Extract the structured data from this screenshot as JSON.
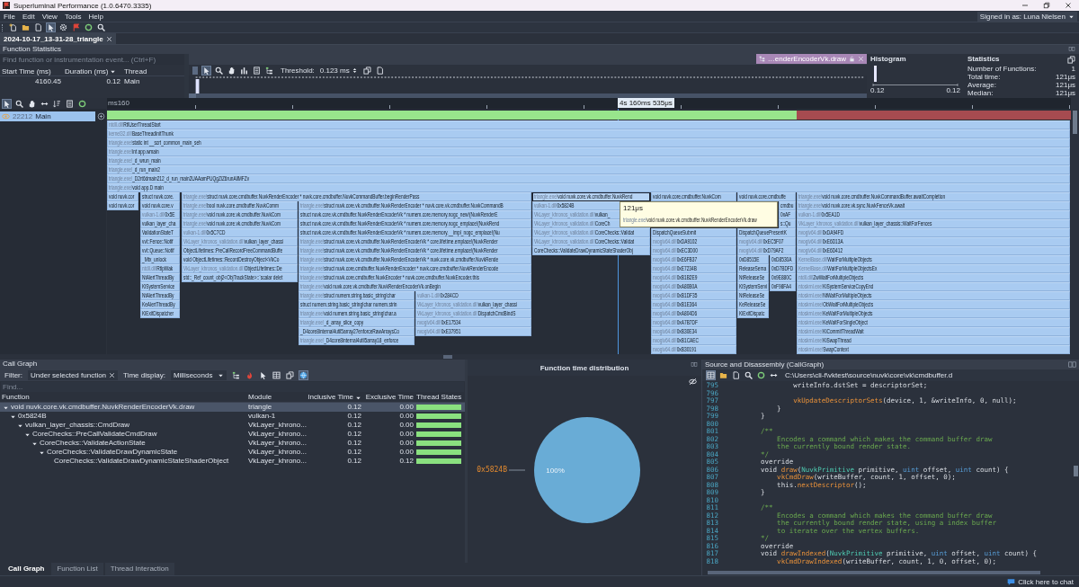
{
  "window": {
    "title": "Superluminal Performance (1.0.6470.3335)"
  },
  "menu": [
    "File",
    "Edit",
    "View",
    "Tools",
    "Help"
  ],
  "account": {
    "label": "Signed in as: Luna Nielsen"
  },
  "document_tabs": [
    {
      "label": "2024-10-17_13-31-28_triangle",
      "selected": true
    }
  ],
  "function_statistics": {
    "title": "Function Statistics",
    "search": {
      "placeholder": "Find function or instrumentation event... (Ctrl+F)"
    },
    "columns": [
      {
        "label": "Start Time (ms)",
        "sorted": false
      },
      {
        "label": "Duration (ms)",
        "sorted": true
      },
      {
        "label": "Thread",
        "sorted": false
      }
    ],
    "rows": [
      [
        "4160.45",
        "0.12",
        "Main"
      ]
    ],
    "threshold_label": "Threshold:",
    "threshold_value": "0.123 ms",
    "selection_tab": "…enderEncoderVk.draw"
  },
  "histogram": {
    "title": "Histogram",
    "min_label": "0.12",
    "max_label": "0.12"
  },
  "statistics": {
    "title": "Statistics",
    "rows": [
      {
        "label": "Number of Functions:",
        "value": "1"
      },
      {
        "label": "Total time:",
        "value": "121μs"
      },
      {
        "label": "Average:",
        "value": "121μs"
      },
      {
        "label": "Median:",
        "value": "121μs"
      }
    ]
  },
  "timeline": {
    "start_label": "ms160",
    "cursor_label": "4s 160ms 535μs"
  },
  "threads": [
    {
      "id": "22212",
      "name": "Main",
      "selected": true
    }
  ],
  "thread_state_segments": [
    {
      "color": "#98e58c"
    },
    {
      "color": "#a64b50"
    }
  ],
  "flame_rows": [
    {
      "blocks": [
        {
          "module": "ntdll.dll!",
          "name": "RtlUserThreadStart",
          "selected": false
        }
      ]
    },
    {
      "blocks": [
        {
          "module": "kernel32.dll!",
          "name": "BaseThreadInitThunk",
          "selected": false
        }
      ]
    },
    {
      "blocks": [
        {
          "module": "triangle.exe!",
          "name": "static int __scrt_common_main_seh",
          "selected": false
        }
      ]
    },
    {
      "blocks": [
        {
          "module": "triangle.exe!",
          "name": "int app.wmain",
          "selected": false
        }
      ]
    },
    {
      "blocks": [
        {
          "module": "triangle.exe!",
          "name": "_d_wrun_main",
          "selected": false
        }
      ]
    },
    {
      "blocks": [
        {
          "module": "triangle.exe!",
          "name": "_d_run_main2",
          "selected": false
        }
      ]
    },
    {
      "blocks": [
        {
          "module": "triangle.exe!",
          "name": "_D2rt6dmain212_d_run_main2UAAamPUQgZiZ6runAllMFZv",
          "selected": false
        }
      ]
    },
    {
      "blocks": [
        {
          "module": "triangle.exe!",
          "name": "void app.D main",
          "selected": false
        }
      ]
    },
    {
      "blocks": [
        {
          "name": "void nuvk.cor",
          "selected": false
        },
        {
          "name": "struct nuvk.core.",
          "selected": false
        },
        {
          "module": "triangle.exe!",
          "name": "struct nuvk.core.cmdbuffer.NuvkRenderEncoder * nuvk.core.cmdbuffer.NuvkCommandBuffer.beginRenderPass",
          "selected": false
        },
        {
          "module": "triangle.exe!",
          "name": "void nuvk.core.vk.cmdbuffer.NuvkRend",
          "selected": true
        },
        {
          "name": "void nuvk.core.cmdbuffer.NuvkCom",
          "selected": false
        },
        {
          "name": "void nuvk.core.cmdbuffe",
          "selected": false
        },
        {
          "module": "triangle.exe!",
          "name": "void nuvk.core.cmdbuffer.NuvkCommandBuffer.awaitCompletion",
          "selected": false
        }
      ]
    },
    {
      "blocks": [
        {
          "name": "void nuvk.cor",
          "selected": false
        },
        {
          "name": "void nuvk.core.v",
          "selected": false
        },
        {
          "module": "triangle.exe!",
          "name": "bool nuvk.core.cmdbuffer.NuvkComm",
          "selected": false
        },
        {
          "module": "triangle.exe!",
          "name": "struct nuvk.core.vk.cmdbuffer.NuvkRenderEncoder * nuvk.core.vk.cmdbuffer.NuvkCommandB",
          "selected": false
        },
        {
          "module": "vulkan-1.dll!",
          "name": "0x5824B",
          "selected": false
        },
        {
          "name": "cmdbu",
          "selected": false
        },
        {
          "module": "triangle.exe!",
          "name": "void nuvk.core.vk.sync.NuvkFenceVk.await",
          "selected": false
        }
      ]
    },
    {
      "blocks": [
        {
          "module": "vulkan-1.dll!",
          "name": "0x5E",
          "selected": false
        },
        {
          "module": "triangle.exe!",
          "name": "void nuvk.core.vk.cmdbuffer.NuvkCom",
          "selected": false
        },
        {
          "name": "struct nuvk.core.vk.cmdbuffer.NuvkRenderEncoderVk * numem.core.memory.nogc_new!(NuvkRenderE",
          "selected": false
        },
        {
          "module": "VkLayer_khronos_validation.dll!",
          "name": "vulkan_",
          "selected": false
        },
        {
          "name": "0xAF",
          "selected": false
        },
        {
          "module": "vulkan-1.dll!",
          "name": "0x5EA1D",
          "selected": false
        }
      ]
    },
    {
      "blocks": [
        {
          "name": "vulkan_layer_cha",
          "selected": false
        },
        {
          "module": "triangle.exe!",
          "name": "void nuvk.core.vk.cmdbuffer.NuvkCom",
          "selected": false
        },
        {
          "name": "struct nuvk.core.vk.cmdbuffer.NuvkRenderEncoderVk * numem.core.memory.nogc_emplace!(NuvkRend",
          "selected": false
        },
        {
          "module": "VkLayer_khronos_validation.dll!",
          "name": "CoreCh",
          "selected": false
        },
        {
          "name": "s::Qu",
          "selected": false
        },
        {
          "module": "VkLayer_khronos_validation.dll!",
          "name": "vulkan_layer_chassis::WaitForFences",
          "selected": false
        }
      ]
    },
    {
      "blocks": [
        {
          "name": "ValidationStateT",
          "selected": false
        },
        {
          "module": "vulkan-1.dll!",
          "name": "0x5C7CD",
          "selected": false
        },
        {
          "name": "struct nuvk.core.vk.cmdbuffer.NuvkRenderEncoderVk * numem.core.memory.__impl_nogc_emplace!(Nu",
          "selected": false
        },
        {
          "module": "VkLayer_khronos_validation.dll!",
          "name": "CoreChecks::Validat",
          "selected": false
        },
        {
          "name": "DispatchQueueSubmit",
          "selected": false
        },
        {
          "name": "DispatchQueuePresentK",
          "selected": false
        },
        {
          "module": "nvoglv64.dll!",
          "name": "0xDA94FD",
          "selected": false
        }
      ]
    },
    {
      "blocks": [
        {
          "name": "vvl::Fence::Notif",
          "selected": false
        },
        {
          "module": "VkLayer_khronos_validation.dll!",
          "name": "vulkan_layer_chassi",
          "selected": false
        },
        {
          "module": "triangle.exe!",
          "name": "struct nuvk.core.vk.cmdbuffer.NuvkRenderEncoderVk * core.lifetime.emplace!(NuvkRender",
          "selected": false
        },
        {
          "module": "VkLayer_khronos_validation.dll!",
          "name": "CoreChecks::Validat",
          "selected": false
        },
        {
          "module": "nvoglv64.dll!",
          "name": "0xDA9102",
          "selected": false
        },
        {
          "module": "nvoglv64.dll!",
          "name": "0xEC5F07",
          "selected": false
        },
        {
          "module": "nvoglv64.dll!",
          "name": "0xE6D13A",
          "selected": false
        }
      ]
    },
    {
      "blocks": [
        {
          "name": "vvl::Queue::Notif",
          "selected": false
        },
        {
          "name": "ObjectLifetimes::PreCallRecordFreeCommandBuffe",
          "selected": false
        },
        {
          "module": "triangle.exe!",
          "name": "struct nuvk.core.vk.cmdbuffer.NuvkRenderEncoderVk * core.lifetime.emplace!(NuvkRender",
          "selected": false
        },
        {
          "name": "CoreChecks::ValidateDrawDynamicStateShaderObj",
          "selected": false
        },
        {
          "module": "nvoglv64.dll!",
          "name": "0xEC3D00",
          "selected": false
        },
        {
          "module": "nvoglv64.dll!",
          "name": "0xD79AF2",
          "selected": false
        },
        {
          "module": "nvoglv64.dll!",
          "name": "0xE6D412",
          "selected": false
        }
      ]
    },
    {
      "blocks": [
        {
          "name": "_Mtx_unlock",
          "selected": false
        },
        {
          "name": "void ObjectLifetimes::RecordDestroyObject<VkCo",
          "selected": false
        },
        {
          "module": "triangle.exe!",
          "name": "struct nuvk.core.vk.cmdbuffer.NuvkRenderEncoderVk * nuvk.core.vk.cmdbuffer.NuvkRende",
          "selected": false
        },
        {
          "module": "nvoglv64.dll!",
          "name": "0xE6FB37",
          "selected": false
        },
        {
          "name": "0xD8515E",
          "selected": false
        },
        {
          "name": "0xD8530A",
          "selected": false
        },
        {
          "module": "KernelBase.dll!",
          "name": "WaitForMultipleObjects",
          "selected": false
        }
      ]
    },
    {
      "blocks": [
        {
          "module": "ntdll.dll!",
          "name": "RtlpWak",
          "selected": false
        },
        {
          "module": "VkLayer_khronos_validation.dll!",
          "name": "ObjectLifetimes::De",
          "selected": false
        },
        {
          "module": "triangle.exe!",
          "name": "struct nuvk.core.cmdbuffer.NuvkRenderEncoder * nuvk.core.cmdbuffer.NuvkRenderEncode",
          "selected": false
        },
        {
          "module": "nvoglv64.dll!",
          "name": "0xE7234B",
          "selected": false
        },
        {
          "name": "ReleaseSema",
          "selected": false
        },
        {
          "name": "0xD7BDFD",
          "selected": false
        },
        {
          "module": "KernelBase.dll!",
          "name": "WaitForMultipleObjectsEx",
          "selected": false
        }
      ]
    },
    {
      "blocks": [
        {
          "name": "NtAlertThreadBy",
          "selected": false
        },
        {
          "name": "std::_Ref_count_obj2<ObjTrackState>::`scalar delet",
          "selected": false
        },
        {
          "module": "triangle.exe!",
          "name": "struct nuvk.core.cmdbuffer.NuvkEncoder * nuvk.core.cmdbuffer.NuvkEncoder.this",
          "selected": false
        },
        {
          "module": "nvoglv64.dll!",
          "name": "0xB1B2E9",
          "selected": false
        },
        {
          "name": "NtReleaseSe",
          "selected": false
        },
        {
          "name": "0x9E880C",
          "selected": false
        },
        {
          "module": "ntdll.dll!",
          "name": "ZwWaitForMultipleObjects",
          "selected": false
        }
      ]
    },
    {
      "blocks": [
        {
          "name": "KiSystemService",
          "selected": false
        },
        {
          "module": "triangle.exe!",
          "name": "void nuvk.core.vk.cmdbuffer.NuvkRenderEncoderVk.onBegin",
          "selected": false
        },
        {
          "module": "nvoglv64.dll!",
          "name": "0xA80B0A",
          "selected": false
        },
        {
          "name": "KiSystemServi",
          "selected": false
        },
        {
          "name": "0xF98FA4",
          "selected": false
        },
        {
          "module": "ntoskrnl.exe!",
          "name": "KiSystemServiceCopyEnd",
          "selected": false
        }
      ]
    },
    {
      "blocks": [
        {
          "name": "NtAlertThreadBy",
          "selected": false
        },
        {
          "module": "triangle.exe!",
          "name": "struct numem.string.basic_string!char",
          "selected": false
        },
        {
          "module": "vulkan-1.dll!",
          "name": "0x284CD",
          "selected": false
        },
        {
          "module": "nvoglv64.dll!",
          "name": "0xB1DF35",
          "selected": false
        },
        {
          "name": "NtReleaseSe",
          "selected": false
        },
        {
          "module": "ntoskrnl.exe!",
          "name": "NtWaitForMultipleObjects",
          "selected": false
        }
      ]
    },
    {
      "blocks": [
        {
          "name": "KeAlertThreadBy",
          "selected": false
        },
        {
          "name": "struct numem.string.basic_string!char numem.strin",
          "selected": false
        },
        {
          "module": "VkLayer_khronos_validation.dll!",
          "name": "vulkan_layer_chassi",
          "selected": false
        },
        {
          "module": "nvoglv64.dll!",
          "name": "0xB1E364",
          "selected": false
        },
        {
          "name": "KeReleaseSe",
          "selected": false
        },
        {
          "module": "ntoskrnl.exe!",
          "name": "ObWaitForMultipleObjects",
          "selected": false
        }
      ]
    },
    {
      "blocks": [
        {
          "name": "KiExitDispatcher",
          "selected": false
        },
        {
          "module": "triangle.exe!",
          "name": "void numem.string.basic_string!char.a",
          "selected": false
        },
        {
          "module": "VkLayer_khronos_validation.dll!",
          "name": "DispatchCmdBindS",
          "selected": false
        },
        {
          "module": "nvoglv64.dll!",
          "name": "0xA804D6",
          "selected": false
        },
        {
          "name": "KiExitDispatc",
          "selected": false
        },
        {
          "module": "ntoskrnl.exe!",
          "name": "KeWaitForMultipleObjects",
          "selected": false
        }
      ]
    },
    {
      "blocks": [
        {
          "module": "triangle.exe!",
          "name": "_d_array_slice_copy",
          "selected": false
        },
        {
          "module": "nvoglv64.dll!",
          "name": "0xE17534",
          "selected": false
        },
        {
          "module": "nvoglv64.dll!",
          "name": "0xA7B7DF",
          "selected": false
        },
        {
          "module": "ntoskrnl.exe!",
          "name": "KeWaitForSingleObject",
          "selected": false
        }
      ]
    },
    {
      "blocks": [
        {
          "name": "_D4core8internal4util5array27enforceRawArraysCo",
          "selected": false
        },
        {
          "module": "nvoglv64.dll!",
          "name": "0xE37951",
          "selected": false
        },
        {
          "module": "nvoglv64.dll!",
          "name": "0xB30E34",
          "selected": false
        },
        {
          "module": "ntoskrnl.exe!",
          "name": "KiCommitThreadWait",
          "selected": false
        }
      ]
    },
    {
      "blocks": [
        {
          "module": "triangle.exe!",
          "name": "_D4core8internal4util5array18_enforce",
          "selected": false
        },
        {
          "module": "nvoglv64.dll!",
          "name": "0xB1CAEC",
          "selected": false
        },
        {
          "module": "ntoskrnl.exe!",
          "name": "KiSwapThread",
          "selected": false
        }
      ]
    },
    {
      "blocks": [
        {
          "module": "nvoglv64.dll!",
          "name": "0xB30191",
          "selected": false
        },
        {
          "module": "ntoskrnl.exe!",
          "name": "SwapContext",
          "selected": false
        }
      ]
    }
  ],
  "tooltip": {
    "duration": "121μs",
    "module": "triangle.exe!",
    "name": "void nuvk.core.vk.cmdbuffer.NuvkRenderEncoderVk.draw"
  },
  "call_graph": {
    "title": "Call Graph",
    "filter_label": "Filter:",
    "filter_value": "Under selected function",
    "time_display_label": "Time display:",
    "time_display_value": "Milliseconds",
    "find_placeholder": "Find...",
    "columns": [
      {
        "label": "Function",
        "sorted": false
      },
      {
        "label": "Module",
        "sorted": false
      },
      {
        "label": "Inclusive Time",
        "sorted": true
      },
      {
        "label": "Exclusive Time",
        "sorted": false
      },
      {
        "label": "Thread States",
        "sorted": false
      }
    ],
    "rows": [
      {
        "function": "void nuvk.core.vk.cmdbuffer.NuvkRenderEncoderVk.draw",
        "module": "triangle",
        "inclusive": "0.12",
        "exclusive": "0.00",
        "selected": true,
        "expanded": true,
        "children": [
          {
            "function": "0x5824B",
            "module": "vulkan-1",
            "inclusive": "0.12",
            "exclusive": "0.00",
            "selected": false,
            "expanded": true,
            "children": [
              {
                "function": "vulkan_layer_chassis::CmdDraw",
                "module": "VkLayer_khrono...",
                "inclusive": "0.12",
                "exclusive": "0.00",
                "selected": false,
                "expanded": true,
                "children": [
                  {
                    "function": "CoreChecks::PreCallValidateCmdDraw",
                    "module": "VkLayer_khrono...",
                    "inclusive": "0.12",
                    "exclusive": "0.00",
                    "selected": false,
                    "expanded": true,
                    "children": [
                      {
                        "function": "CoreChecks::ValidateActionState",
                        "module": "VkLayer_khrono...",
                        "inclusive": "0.12",
                        "exclusive": "0.00",
                        "selected": false,
                        "expanded": true,
                        "children": [
                          {
                            "function": "CoreChecks::ValidateDrawDynamicState",
                            "module": "VkLayer_khrono...",
                            "inclusive": "0.12",
                            "exclusive": "0.00",
                            "selected": false,
                            "expanded": true,
                            "children": [
                              {
                                "function": "CoreChecks::ValidateDrawDynamicStateShaderObject",
                                "module": "VkLayer_khrono...",
                                "inclusive": "0.12",
                                "exclusive": "0.12",
                                "selected": false
                              }
                            ]
                          }
                        ]
                      }
                    ]
                  }
                ]
              }
            ]
          }
        ]
      }
    ]
  },
  "time_distribution": {
    "chart_data": {
      "type": "pie",
      "title": "Function time distribution",
      "categories": [
        "0x5824B"
      ],
      "values": [
        100
      ],
      "value_labels": [
        "100%"
      ]
    }
  },
  "source": {
    "title": "Source and Disassembly (CallGraph)",
    "path": "C:\\Users\\cli-f\\vktest\\source\\nuvk\\core\\vk\\cmdbuffer.d",
    "lines": [
      {
        "number": "795",
        "tokens": [
          {
            "kind": "plain",
            "text": "            writeInfo.dstSet = descriptorSet;"
          }
        ]
      },
      {
        "number": "796"
      },
      {
        "number": "797",
        "tokens": [
          {
            "kind": "function",
            "text": "            vkUpdateDescriptorSets"
          },
          {
            "kind": "plain",
            "text": "(device, 1, &writeInfo, 0, null);"
          }
        ]
      },
      {
        "number": "798",
        "tokens": [
          {
            "kind": "plain",
            "text": "        }"
          }
        ]
      },
      {
        "number": "799",
        "tokens": [
          {
            "kind": "plain",
            "text": "    }"
          }
        ]
      },
      {
        "number": "800"
      },
      {
        "number": "801",
        "tokens": [
          {
            "kind": "comment",
            "text": "    /**"
          }
        ]
      },
      {
        "number": "802",
        "tokens": [
          {
            "kind": "comment",
            "text": "        Encodes a command which makes the command buffer draw"
          }
        ]
      },
      {
        "number": "803",
        "tokens": [
          {
            "kind": "comment",
            "text": "        the currently bound render state."
          }
        ]
      },
      {
        "number": "804",
        "tokens": [
          {
            "kind": "comment",
            "text": "    */"
          }
        ]
      },
      {
        "number": "805",
        "tokens": [
          {
            "kind": "plain",
            "text": "    override"
          }
        ]
      },
      {
        "number": "806",
        "tokens": [
          {
            "kind": "plain",
            "text": "    void "
          },
          {
            "kind": "function",
            "text": "draw"
          },
          {
            "kind": "plain",
            "text": "("
          },
          {
            "kind": "type",
            "text": "NuvkPrimitive"
          },
          {
            "kind": "plain",
            "text": " primitive, "
          },
          {
            "kind": "builtin",
            "text": "uint"
          },
          {
            "kind": "plain",
            "text": " offset, "
          },
          {
            "kind": "builtin",
            "text": "uint"
          },
          {
            "kind": "plain",
            "text": " count) {"
          }
        ]
      },
      {
        "number": "807",
        "tokens": [
          {
            "kind": "function",
            "text": "        vkCmdDraw"
          },
          {
            "kind": "plain",
            "text": "(writeBuffer, count, 1, offset, 0);"
          }
        ]
      },
      {
        "number": "808",
        "tokens": [
          {
            "kind": "plain",
            "text": "        this."
          },
          {
            "kind": "function",
            "text": "nextDescriptor"
          },
          {
            "kind": "plain",
            "text": "();"
          }
        ]
      },
      {
        "number": "809",
        "tokens": [
          {
            "kind": "plain",
            "text": "    }"
          }
        ]
      },
      {
        "number": "810"
      },
      {
        "number": "811",
        "tokens": [
          {
            "kind": "comment",
            "text": "    /**"
          }
        ]
      },
      {
        "number": "812",
        "tokens": [
          {
            "kind": "comment",
            "text": "        Encodes a command which makes the command buffer draw"
          }
        ]
      },
      {
        "number": "813",
        "tokens": [
          {
            "kind": "comment",
            "text": "        the currently bound render state, using a index buffer"
          }
        ]
      },
      {
        "number": "814",
        "tokens": [
          {
            "kind": "comment",
            "text": "        to iterate over the vertex buffers."
          }
        ]
      },
      {
        "number": "815",
        "tokens": [
          {
            "kind": "comment",
            "text": "    */"
          }
        ]
      },
      {
        "number": "816",
        "tokens": [
          {
            "kind": "plain",
            "text": "    override"
          }
        ]
      },
      {
        "number": "817",
        "tokens": [
          {
            "kind": "plain",
            "text": "    void "
          },
          {
            "kind": "function",
            "text": "drawIndexed"
          },
          {
            "kind": "plain",
            "text": "("
          },
          {
            "kind": "type",
            "text": "NuvkPrimitive"
          },
          {
            "kind": "plain",
            "text": " primitive, "
          },
          {
            "kind": "builtin",
            "text": "uint"
          },
          {
            "kind": "plain",
            "text": " offset, "
          },
          {
            "kind": "builtin",
            "text": "uint"
          },
          {
            "kind": "plain",
            "text": " count) {"
          }
        ]
      },
      {
        "number": "818",
        "tokens": [
          {
            "kind": "function",
            "text": "        vkCmdDrawIndexed"
          },
          {
            "kind": "plain",
            "text": "(writeBuffer, count, 1, 0, offset, 0);"
          }
        ]
      }
    ]
  },
  "bottom_tabs": [
    {
      "label": "Call Graph",
      "selected": true
    },
    {
      "label": "Function List",
      "selected": false
    },
    {
      "label": "Thread Interaction",
      "selected": false
    }
  ],
  "status_bar": {
    "chat": "Click here to chat"
  }
}
